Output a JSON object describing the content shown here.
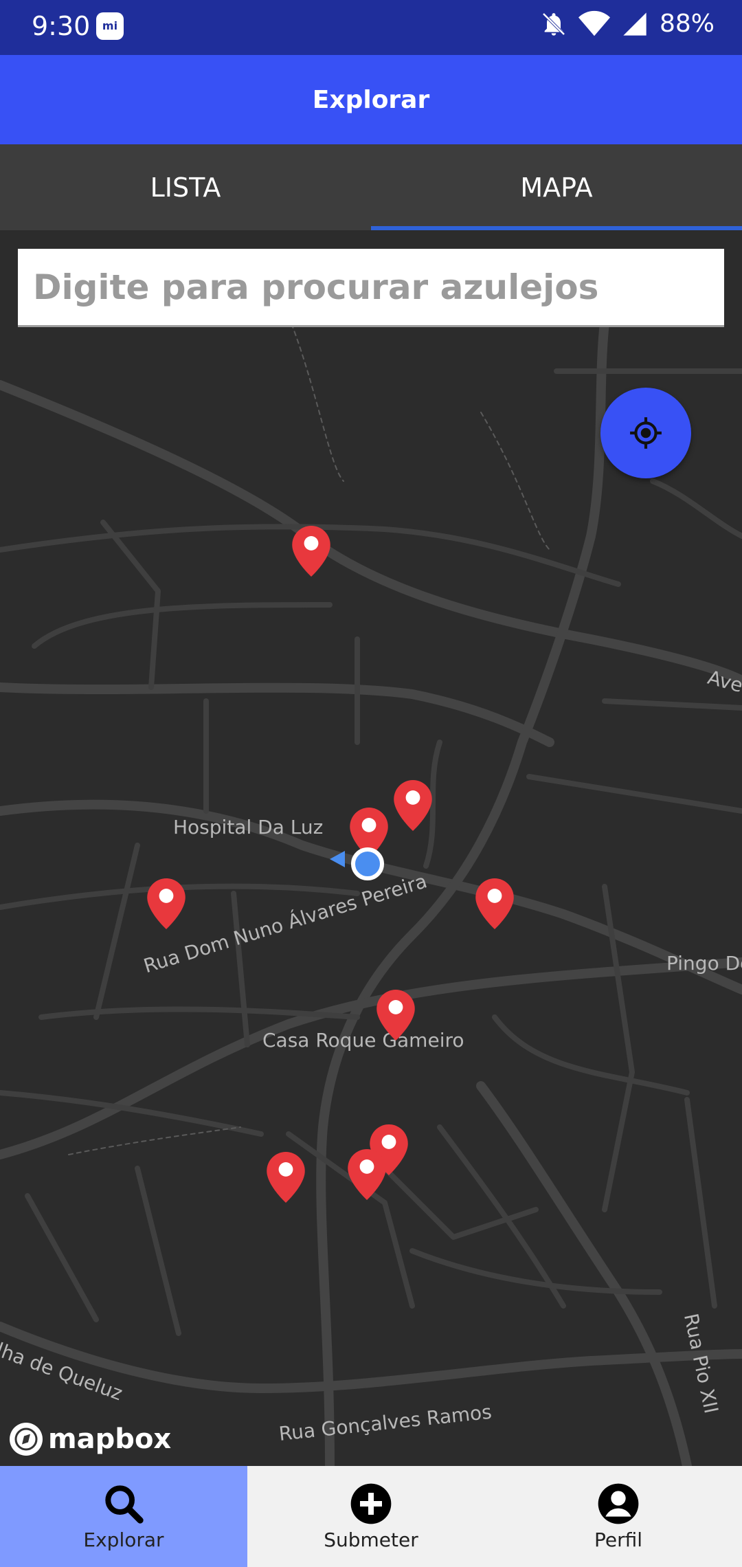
{
  "status_bar": {
    "time": "9:30",
    "battery": "88%"
  },
  "app_bar": {
    "title": "Explorar"
  },
  "tabs": [
    {
      "label": "LISTA",
      "active": false
    },
    {
      "label": "MAPA",
      "active": true
    }
  ],
  "search": {
    "placeholder": "Digite para procurar azulejos",
    "value": ""
  },
  "map": {
    "labels": {
      "hospital": "Hospital Da Luz",
      "rua_nuno": "Rua Dom Nuno Álvares Pereira",
      "casa": "Casa Roque Gameiro",
      "estrada": "Estrada Velha de Queluz",
      "rua_goncalves": "Rua Gonçalves Ramos",
      "rua_pio": "Rua Pio XII",
      "pingo": "Pingo Doce",
      "ave": "Ave"
    },
    "attribution": "mapbox",
    "pin_color": "#e8383d",
    "pin_count": 9
  },
  "bottom_nav": [
    {
      "label": "Explorar",
      "icon": "search-icon",
      "active": true
    },
    {
      "label": "Submeter",
      "icon": "add-circle-icon",
      "active": false
    },
    {
      "label": "Perfil",
      "icon": "account-icon",
      "active": false
    }
  ],
  "colors": {
    "status_bar": "#1f2e9b",
    "accent": "#3851f5",
    "nav_active": "#7f9aff",
    "map_bg": "#2c2c2c"
  }
}
